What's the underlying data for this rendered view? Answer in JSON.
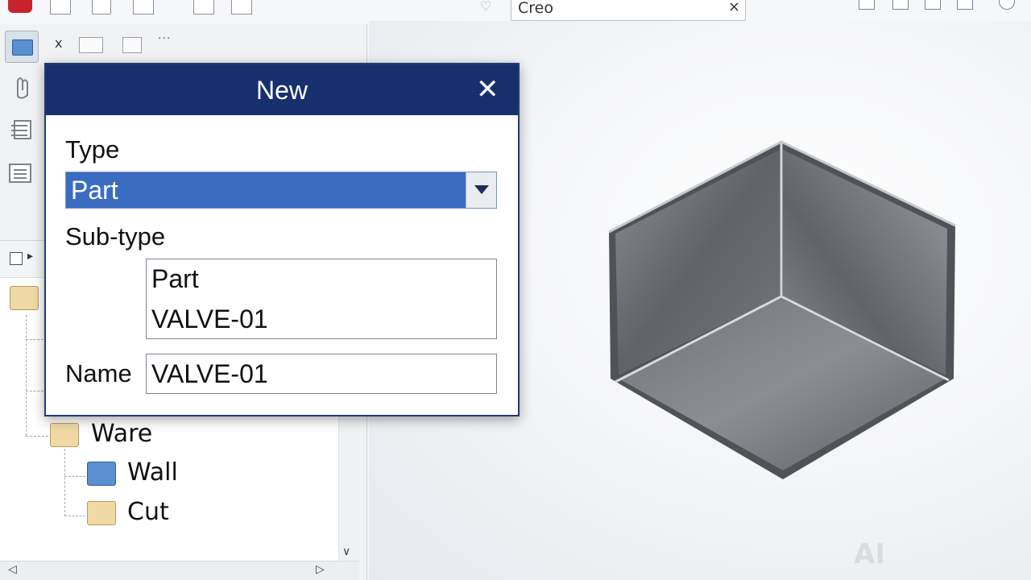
{
  "toolbar": {
    "search_text": "Creo",
    "search_clear": "×"
  },
  "left_panel": {
    "mini_close": "x",
    "mini_more": "···",
    "tree": {
      "items": [
        {
          "label": "Ware",
          "icon": "folder-tan-icon"
        },
        {
          "label": "Wall",
          "icon": "folder-blue-icon"
        },
        {
          "label": "Cut",
          "icon": "folder-tan-icon"
        }
      ]
    },
    "scroll_left": "◁",
    "scroll_right": "▷",
    "scroll_down": "∨"
  },
  "dialog": {
    "title": "New",
    "close": "✕",
    "type_label": "Type",
    "type_value": "Part",
    "subtype_label": "Sub-type",
    "subtype_items": [
      "Part",
      "VALVE-01"
    ],
    "name_label": "Name",
    "name_value": "VALVE-01"
  },
  "viewport": {
    "watermark": "AI"
  },
  "colors": {
    "dialog_title_bg": "#17306d",
    "selected_bg": "#3a6cc2",
    "folder_blue": "#5a8fd1",
    "folder_tan": "#f0d9a4"
  }
}
